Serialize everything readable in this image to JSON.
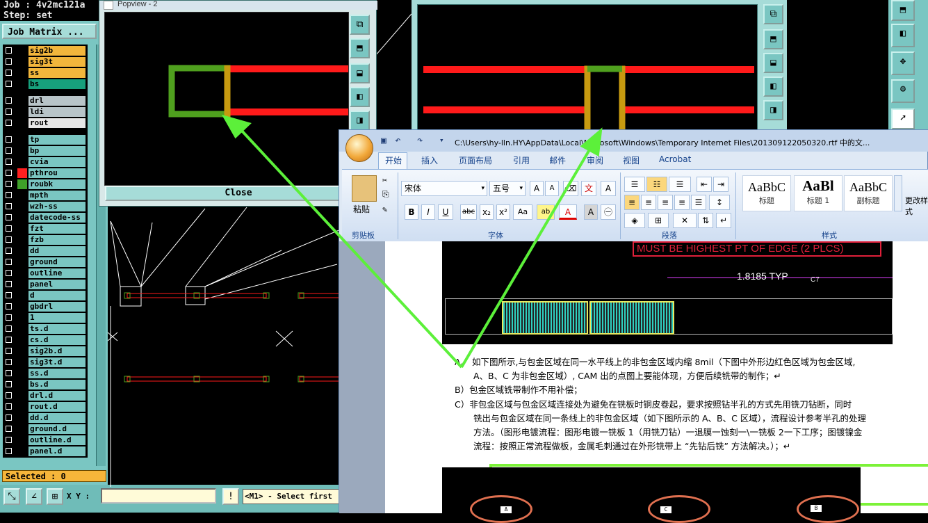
{
  "cam": {
    "header_job": "Job : 4v2mc121a",
    "header_step": "Step: set",
    "job_matrix_label": "Job Matrix ...",
    "layers": [
      {
        "name": "sig2b",
        "color": "#f2b63c",
        "chip": "#000000"
      },
      {
        "name": "sig3t",
        "color": "#f2b63c",
        "chip": "#000000"
      },
      {
        "name": "ss",
        "color": "#f2b63c",
        "chip": "#000000"
      },
      {
        "name": "bs",
        "color": "#17a07c",
        "chip": "#000000"
      },
      {
        "name": "drl",
        "color": "#b8c4c8",
        "chip": "#000000"
      },
      {
        "name": "ldi",
        "color": "#b8c4c8",
        "chip": "#000000"
      },
      {
        "name": "rout",
        "color": "#e6e6e6",
        "chip": "#000000"
      },
      {
        "name": "tp",
        "color": "#7ac6c2",
        "chip": "#000000"
      },
      {
        "name": "bp",
        "color": "#7ac6c2",
        "chip": "#000000"
      },
      {
        "name": "cvia",
        "color": "#7ac6c2",
        "chip": "#000000"
      },
      {
        "name": "pthrou",
        "color": "#7ac6c2",
        "chip": "#ff2020"
      },
      {
        "name": "roubk",
        "color": "#7ac6c2",
        "chip": "#3fa22a"
      },
      {
        "name": "mpth",
        "color": "#7ac6c2",
        "chip": "#000000"
      },
      {
        "name": "wzh-ss",
        "color": "#7ac6c2",
        "chip": "#000000"
      },
      {
        "name": "datecode-ss",
        "color": "#7ac6c2",
        "chip": "#000000"
      },
      {
        "name": "fzt",
        "color": "#7ac6c2",
        "chip": "#000000"
      },
      {
        "name": "fzb",
        "color": "#7ac6c2",
        "chip": "#000000"
      },
      {
        "name": "dd",
        "color": "#7ac6c2",
        "chip": "#000000"
      },
      {
        "name": "ground",
        "color": "#7ac6c2",
        "chip": "#000000"
      },
      {
        "name": "outline",
        "color": "#7ac6c2",
        "chip": "#000000"
      },
      {
        "name": "panel",
        "color": "#7ac6c2",
        "chip": "#000000"
      },
      {
        "name": "d",
        "color": "#7ac6c2",
        "chip": "#000000"
      },
      {
        "name": "gbdrl",
        "color": "#7ac6c2",
        "chip": "#000000"
      },
      {
        "name": "1",
        "color": "#7ac6c2",
        "chip": "#000000"
      },
      {
        "name": "ts.d",
        "color": "#7ac6c2",
        "chip": "#000000"
      },
      {
        "name": "cs.d",
        "color": "#7ac6c2",
        "chip": "#000000"
      },
      {
        "name": "sig2b.d",
        "color": "#7ac6c2",
        "chip": "#000000"
      },
      {
        "name": "sig3t.d",
        "color": "#7ac6c2",
        "chip": "#000000"
      },
      {
        "name": "ss.d",
        "color": "#7ac6c2",
        "chip": "#000000"
      },
      {
        "name": "bs.d",
        "color": "#7ac6c2",
        "chip": "#000000"
      },
      {
        "name": "drl.d",
        "color": "#7ac6c2",
        "chip": "#000000"
      },
      {
        "name": "rout.d",
        "color": "#7ac6c2",
        "chip": "#000000"
      },
      {
        "name": "dd.d",
        "color": "#7ac6c2",
        "chip": "#000000"
      },
      {
        "name": "ground.d",
        "color": "#7ac6c2",
        "chip": "#000000"
      },
      {
        "name": "outline.d",
        "color": "#7ac6c2",
        "chip": "#000000"
      },
      {
        "name": "panel.d",
        "color": "#7ac6c2",
        "chip": "#000000"
      }
    ],
    "selected": "Selected : 0",
    "xy_label": "X Y :",
    "xy_value": "",
    "warning_label": "!",
    "message": "<M1> - Select first"
  },
  "popview": {
    "title": "Popview - 2",
    "close_label": "Close"
  },
  "word": {
    "title": "C:\\Users\\hy-lln.HY\\AppData\\Local\\Microsoft\\Windows\\Temporary Internet Files\\201309122050320.rtf 中的文...",
    "tabs": [
      "开始",
      "插入",
      "页面布局",
      "引用",
      "邮件",
      "审阅",
      "视图",
      "Acrobat"
    ],
    "active_tab": "开始",
    "clipboard": {
      "paste": "粘贴",
      "group": "剪贴板"
    },
    "font": {
      "name": "宋体",
      "size": "五号",
      "group": "字体"
    },
    "paragraph_group": "段落",
    "styles": {
      "group": "样式",
      "items": [
        {
          "preview": "AaBbC",
          "name": "标题"
        },
        {
          "preview": "AaBl",
          "name": "标题 1"
        },
        {
          "preview": "AaBbC",
          "name": "副标题"
        }
      ],
      "change_styles": "更改样式"
    },
    "document": {
      "figure_callout": "MUST BE HIGHEST PT OF EDGE (2 PLCS)",
      "figure_dimension": "1.8185 TYP",
      "figure_ref": "C7",
      "lines": [
        "A、 如下图所示,与包金区域在同一水平线上的非包金区域内缩 8mil（下图中外形边红色区域为包金区域,",
        "A、B、C 为非包金区域）, CAM 出的点图上要能体现，方便后续铣带的制作；↵",
        "B）包金区域铣带制作不用补偿；",
        "C）非包金区域与包金区域连接处为避免在铣板时铜皮卷起，要求按照钻半孔的方式先用铣刀钻断，同时",
        "铣出与包金区域在同一条线上的非包金区域（如下图所示的 A、B、C 区域），流程设计参考半孔的处理",
        "方法。（图形电镀流程：图形电镀一铣板 1（用铣刀钻）一退膜一蚀刻一\\一铣板 2一下工序；图镀镍金",
        "流程：按照正常流程做板，金属毛刺通过在外形铣带上 “先钻后铣” 方法解决。）；↵"
      ],
      "figure2_labels": [
        "A",
        "C",
        "B"
      ]
    }
  },
  "colors": {
    "cam_bg": "#7ac6c2",
    "trace_red": "#ff1a1a",
    "pad_green": "#4fa01e",
    "pad_gold": "#c79a10",
    "arrow_green": "#5cf03a"
  }
}
